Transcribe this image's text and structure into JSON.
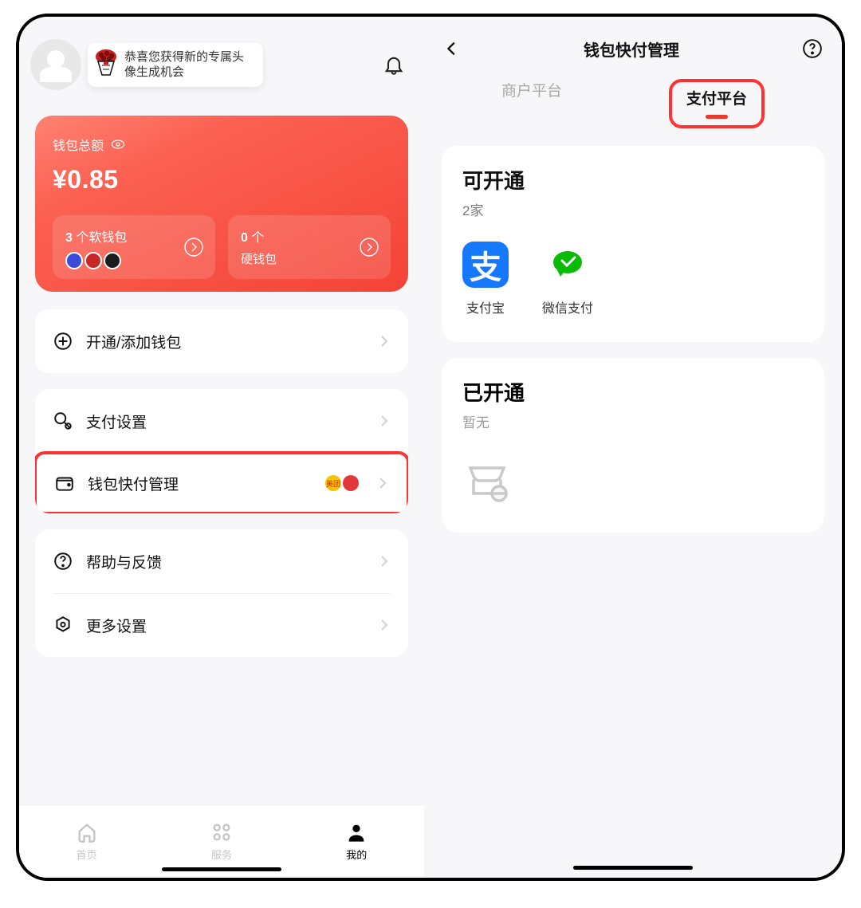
{
  "left": {
    "avatar_bubble": "恭喜您获得新的专属头像生成机会",
    "wallet": {
      "balance_label": "钱包总额",
      "amount": "¥0.85",
      "soft": {
        "count": "3",
        "unit": "个软钱包"
      },
      "hard": {
        "count": "0",
        "unit": "个",
        "label": "硬钱包"
      }
    },
    "menu": {
      "add": "开通/添加钱包",
      "pay_settings": "支付设置",
      "quickpay": "钱包快付管理",
      "help": "帮助与反馈",
      "more": "更多设置"
    },
    "tabs": {
      "home": "首页",
      "service": "服务",
      "mine": "我的"
    }
  },
  "right": {
    "title": "钱包快付管理",
    "tab_merchant": "商户平台",
    "tab_payment": "支付平台",
    "openable": {
      "title": "可开通",
      "count": "2家",
      "alipay": "支付宝",
      "wechat": "微信支付"
    },
    "opened": {
      "title": "已开通",
      "none": "暂无"
    }
  }
}
